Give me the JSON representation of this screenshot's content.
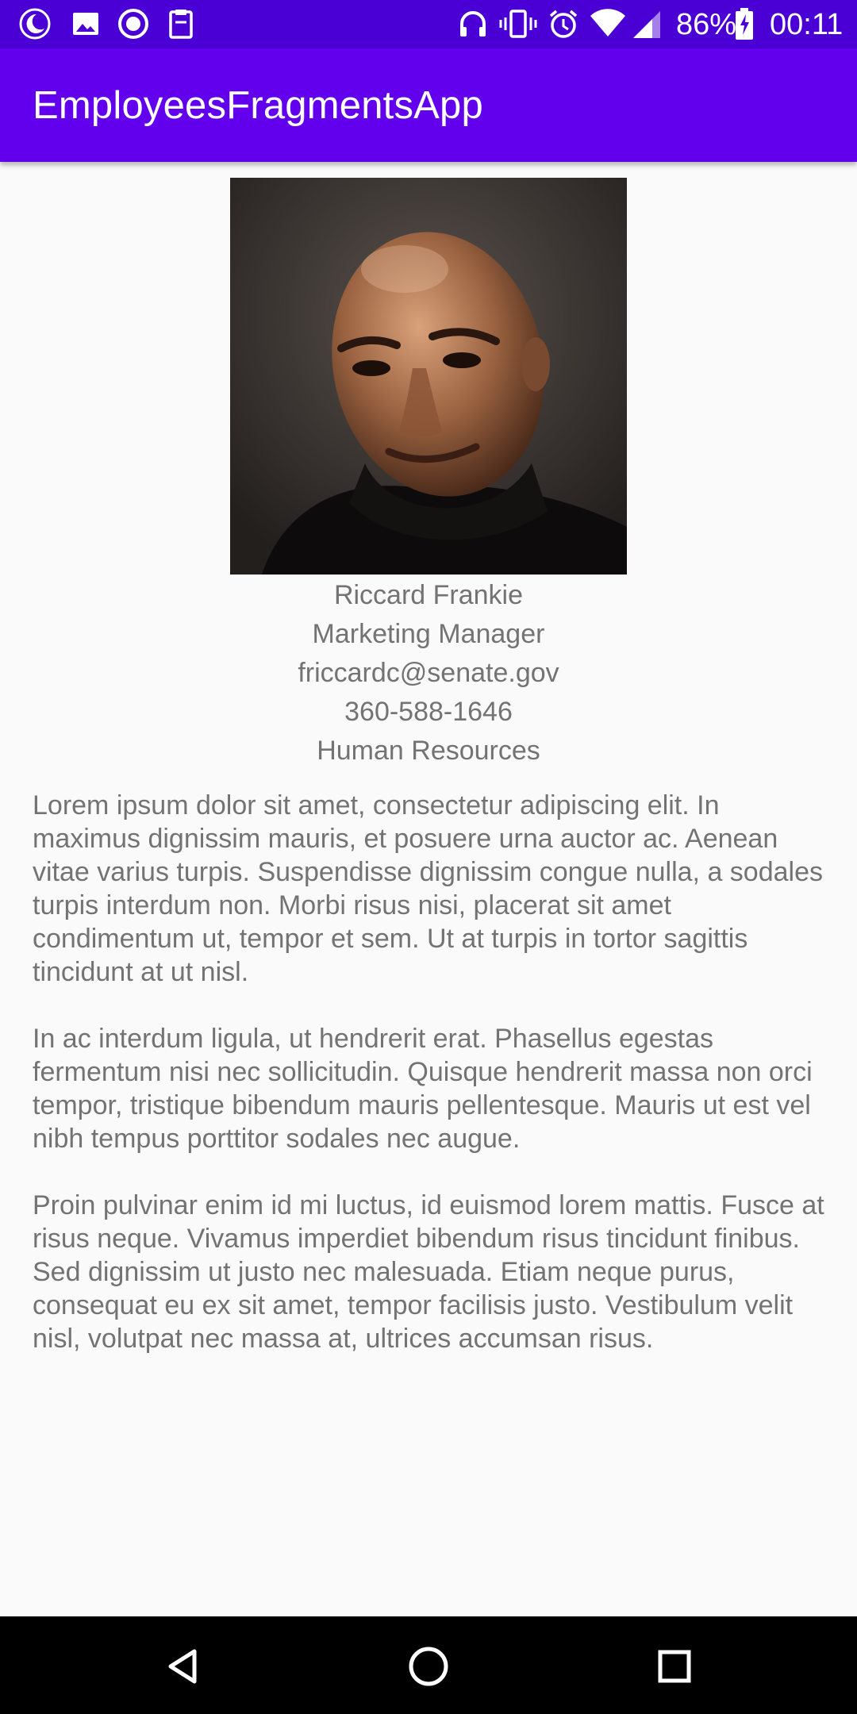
{
  "status_bar": {
    "battery": "86%",
    "time": "00:11",
    "left_icons": [
      "moon-icon",
      "image-icon",
      "circle-app-icon",
      "clipboard-icon"
    ],
    "right_icons": [
      "headphones-icon",
      "vibrate-icon",
      "alarm-icon",
      "wifi-icon",
      "signal-icon",
      "battery-charging-icon"
    ]
  },
  "app_bar": {
    "title": "EmployeesFragmentsApp",
    "color": "#6200ee"
  },
  "employee": {
    "photo_alt": "employee-photo",
    "name": "Riccard Frankie",
    "title": "Marketing Manager",
    "email": "friccardc@senate.gov",
    "phone": "360-588-1646",
    "department": "Human Resources",
    "bio": [
      "Lorem ipsum dolor sit amet, consectetur adipiscing elit. In maximus dignissim mauris, et posuere urna auctor ac. Aenean vitae varius turpis. Suspendisse dignissim congue nulla, a sodales turpis interdum non. Morbi risus nisi, placerat sit amet condimentum ut, tempor et sem. Ut at turpis in tortor sagittis tincidunt at ut nisl.",
      "In ac interdum ligula, ut hendrerit erat. Phasellus egestas fermentum nisi nec sollicitudin. Quisque hendrerit massa non orci tempor, tristique bibendum mauris pellentesque. Mauris ut est vel nibh tempus porttitor sodales nec augue.",
      "Proin pulvinar enim id mi luctus, id euismod lorem mattis. Fusce at risus neque. Vivamus imperdiet bibendum risus tincidunt finibus. Sed dignissim ut justo nec malesuada. Etiam neque purus, consequat eu ex sit amet, tempor facilisis justo. Vestibulum velit nisl, volutpat nec massa at, ultrices accumsan risus."
    ]
  },
  "nav_bar": {
    "buttons": [
      "back-icon",
      "home-icon",
      "recents-icon"
    ]
  }
}
